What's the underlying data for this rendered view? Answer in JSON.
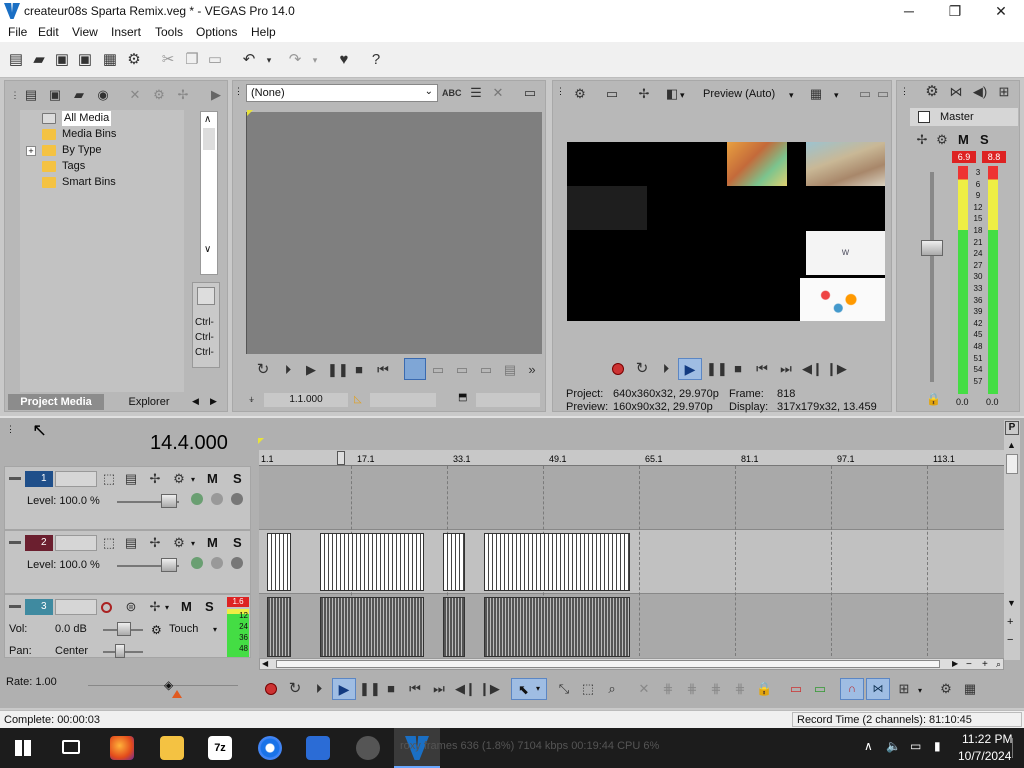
{
  "window": {
    "title": "createur08s Sparta Remix.veg * - VEGAS Pro 14.0",
    "min_label": "─",
    "max_label": "❐",
    "close_label": "✕"
  },
  "menu": [
    "File",
    "Edit",
    "View",
    "Insert",
    "Tools",
    "Options",
    "Help"
  ],
  "project_media": {
    "tree": [
      "All Media",
      "Media Bins",
      "By Type",
      "Tags",
      "Smart Bins"
    ],
    "expander": "+",
    "ctrl_labels": [
      "Ctrl-",
      "Ctrl-",
      "Ctrl-"
    ],
    "tabs": [
      "Project Media",
      "Explorer"
    ]
  },
  "trimmer": {
    "dropdown_value": "(None)",
    "position": "1.1.000"
  },
  "preview": {
    "quality": "Preview (Auto)",
    "project_label": "Project:",
    "project_value": "640x360x32, 29.970p",
    "preview_label": "Preview:",
    "preview_value": "160x90x32, 29.970p",
    "frame_label": "Frame:",
    "frame_value": "818",
    "display_label": "Display:",
    "display_value": "317x179x32, 13.459",
    "watermark": "w"
  },
  "master": {
    "label": "Master",
    "peak_left": "6.9",
    "peak_right": "8.8",
    "scale": [
      "3",
      "6",
      "9",
      "12",
      "15",
      "18",
      "21",
      "24",
      "27",
      "30",
      "33",
      "36",
      "39",
      "42",
      "45",
      "48",
      "51",
      "54",
      "57"
    ],
    "db_left": "0.0",
    "db_right": "0.0"
  },
  "timeline": {
    "cursor_time": "14.4.000",
    "ruler": [
      "1.1",
      "17.1",
      "33.1",
      "49.1",
      "65.1",
      "81.1",
      "97.1",
      "113.1"
    ],
    "tracks": [
      {
        "number": "1",
        "level_label": "Level: 100.0 %"
      },
      {
        "number": "2",
        "level_label": "Level: 100.0 %"
      },
      {
        "number": "3",
        "vol_label": "Vol:",
        "vol_value": "0.0 dB",
        "pan_label": "Pan:",
        "pan_value": "Center",
        "mode": "Touch",
        "peak": "1.6",
        "meter_ticks": [
          "12",
          "24",
          "36",
          "48"
        ]
      }
    ],
    "mute": "M",
    "solo": "S",
    "rate": "Rate: 1.00",
    "side_p": "P"
  },
  "status": {
    "complete": "Complete: 00:00:03",
    "record_time": "Record Time (2 channels): 81:10:45"
  },
  "taskbar": {
    "time": "11:22 PM",
    "date": "10/7/2024",
    "ghost": "roxy frames 636 (1.8%)    7104 kbps    00:19:44    CPU 6%"
  },
  "colors": {
    "track1": "#1f4f8a",
    "track2": "#6b1f2f",
    "track3": "#3f8aa0",
    "meter_green": "#44d64a",
    "meter_yellow": "#e7e23b",
    "meter_red": "#e23b3b"
  }
}
